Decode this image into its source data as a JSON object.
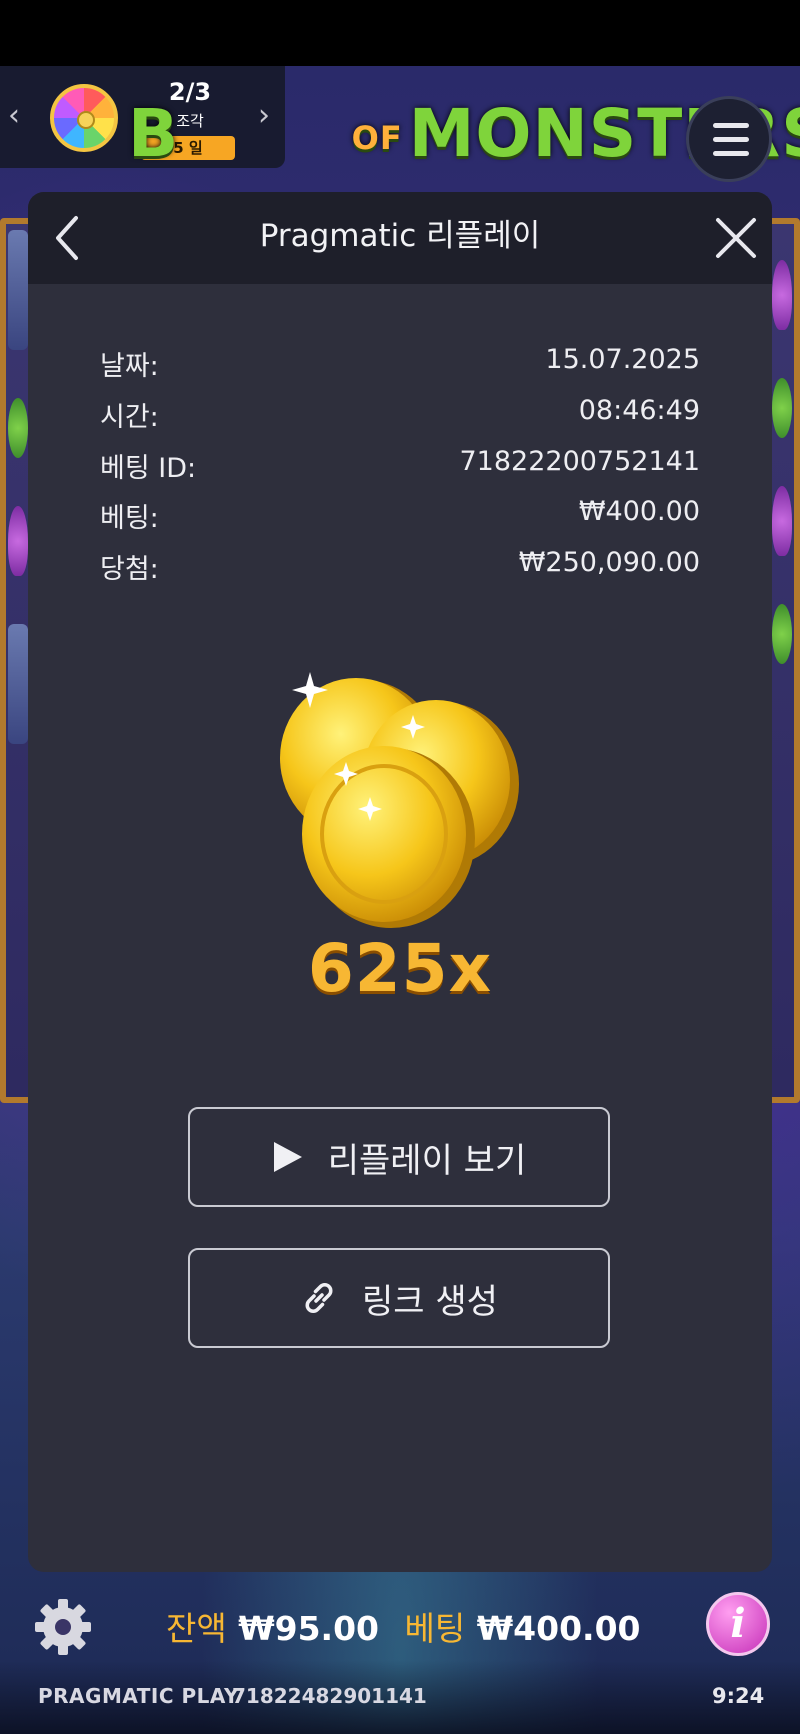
{
  "promo": {
    "progress": "2/3",
    "label": "조각",
    "days": "5 일"
  },
  "game": {
    "logo_left": "B",
    "logo_of": "OF",
    "logo_right": "MONSTERS"
  },
  "modal": {
    "title": "Pragmatic 리플레이",
    "info": [
      {
        "label": "날짜:",
        "value": "15.07.2025"
      },
      {
        "label": "시간:",
        "value": "08:46:49"
      },
      {
        "label": "베팅 ID:",
        "value": "71822200752141"
      },
      {
        "label": "베팅:",
        "value": "₩400.00"
      },
      {
        "label": "당첨:",
        "value": "₩250,090.00"
      }
    ],
    "multiplier": "625x",
    "watch_replay_label": "리플레이 보기",
    "create_link_label": "링크 생성"
  },
  "bottom": {
    "balance_label": "잔액",
    "balance_value": "₩95.00",
    "bet_label": "베팅",
    "bet_value": "₩400.00",
    "provider": "PRAGMATIC PLAY",
    "round_id": "71822482901141",
    "time": "9:24"
  },
  "colors": {
    "accent": "#f7b733",
    "modal_bg": "#2e2f3c",
    "modal_header_bg": "#1e1f2a"
  }
}
